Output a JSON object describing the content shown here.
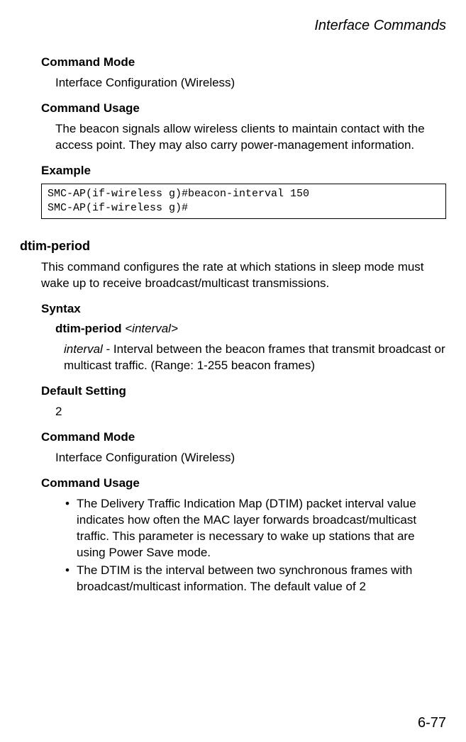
{
  "header": {
    "running_title": "Interface Commands"
  },
  "sections": {
    "command_mode_heading_1": "Command Mode",
    "command_mode_body_1": "Interface Configuration (Wireless)",
    "command_usage_heading_1": "Command Usage",
    "command_usage_body_1": "The beacon signals allow wireless clients to maintain contact with the access point. They may also carry power-management information.",
    "example_heading": "Example",
    "example_code": "SMC-AP(if-wireless g)#beacon-interval 150\nSMC-AP(if-wireless g)#",
    "dtim_heading": "dtim-period",
    "dtim_intro": "This command configures the rate at which stations in sleep mode must wake up to receive broadcast/multicast transmissions.",
    "syntax_heading": "Syntax",
    "syntax_cmd": "dtim-period",
    "syntax_arg": "<interval>",
    "syntax_param_name": "interval",
    "syntax_param_sep": " - ",
    "syntax_param_desc": "Interval between the beacon frames that transmit broadcast or multicast traffic. (Range: 1-255 beacon frames)",
    "default_setting_heading": "Default Setting",
    "default_setting_value": "2",
    "command_mode_heading_2": "Command Mode",
    "command_mode_body_2": "Interface Configuration (Wireless)",
    "command_usage_heading_2": "Command Usage",
    "usage_bullets": [
      "The Delivery Traffic Indication Map (DTIM) packet interval value indicates how often the MAC layer forwards broadcast/multicast traffic. This parameter is necessary to wake up stations that are using Power Save mode.",
      "The DTIM is the interval between two synchronous frames with broadcast/multicast information. The default value of 2"
    ]
  },
  "footer": {
    "page_number": "6-77"
  }
}
